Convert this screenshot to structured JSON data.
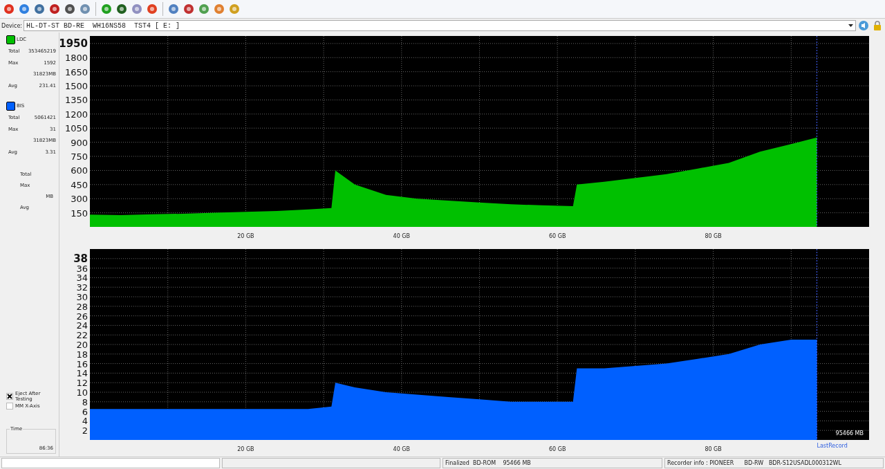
{
  "device": {
    "label": "Device:",
    "value": "HL-DT-ST BD-RE  WH16NS58  TST4 [ E: ]"
  },
  "stats": [
    {
      "rows": [
        {
          "label": "Total",
          "value": "353465219"
        },
        {
          "label": "Max",
          "value": "1592"
        },
        {
          "label": "",
          "value": "31823MB"
        },
        {
          "label": "Avg",
          "value": "231.41"
        }
      ]
    },
    {
      "rows": [
        {
          "label": "Total",
          "value": "5061421"
        },
        {
          "label": "Max",
          "value": "31"
        },
        {
          "label": "",
          "value": "31823MB"
        },
        {
          "label": "Avg",
          "value": "3.31"
        }
      ]
    }
  ],
  "extra_stats": [
    "Total",
    "Max",
    "MB",
    "Avg"
  ],
  "options": [
    {
      "label": "Eject After Testing",
      "checked": true
    },
    {
      "label": "MM X-Axis",
      "checked": false
    }
  ],
  "time": {
    "label": "Time",
    "value": "86:36"
  },
  "charts": [
    {
      "chart_data": {
        "type": "area",
        "grid": true,
        "ref_lines": [
          {
            "axis": "x",
            "value": 93.3
          }
        ],
        "xlim": [
          0,
          100
        ],
        "ylim": [
          0,
          2030
        ],
        "xticks": [
          {
            "value": 20,
            "label": "20 GB"
          },
          {
            "value": 40,
            "label": "40 GB"
          },
          {
            "value": 60,
            "label": "60 GB"
          },
          {
            "value": 80,
            "label": "80 GB"
          }
        ],
        "yticks": [
          150,
          300,
          450,
          600,
          750,
          900,
          1050,
          1200,
          1350,
          1500,
          1650,
          1800,
          1950
        ],
        "x": [
          0,
          4,
          8,
          12,
          16,
          20,
          24,
          28,
          31,
          31.5,
          34,
          38,
          42,
          46,
          50,
          54,
          58,
          62,
          62.5,
          66,
          70,
          74,
          78,
          82,
          86,
          90,
          93.3
        ],
        "series": [
          {
            "name": "LDC",
            "color": "#00c000",
            "values": [
              130,
              125,
              135,
              140,
              150,
              160,
              170,
              185,
              200,
              600,
              450,
              340,
              300,
              280,
              260,
              240,
              230,
              220,
              450,
              480,
              520,
              560,
              620,
              680,
              800,
              880,
              950
            ]
          }
        ]
      }
    },
    {
      "chart_data": {
        "type": "area",
        "grid": true,
        "ref_lines": [
          {
            "axis": "x",
            "value": 93.3
          }
        ],
        "xlim": [
          0,
          100
        ],
        "ylim": [
          0,
          40
        ],
        "xticks": [
          {
            "value": 20,
            "label": "20 GB"
          },
          {
            "value": 40,
            "label": "40 GB"
          },
          {
            "value": 60,
            "label": "60 GB"
          },
          {
            "value": 80,
            "label": "80 GB"
          }
        ],
        "yticks": [
          2,
          4,
          6,
          8,
          10,
          12,
          14,
          16,
          18,
          20,
          22,
          24,
          26,
          28,
          30,
          32,
          34,
          36,
          38
        ],
        "x": [
          0,
          4,
          8,
          12,
          16,
          20,
          24,
          28,
          31,
          31.5,
          34,
          38,
          42,
          46,
          50,
          54,
          58,
          62,
          62.5,
          66,
          70,
          74,
          78,
          82,
          86,
          90,
          93.3
        ],
        "series": [
          {
            "name": "BIS",
            "color": "#0060ff",
            "values": [
              6.5,
              6.5,
              6.5,
              6.5,
              6.5,
              6.5,
              6.5,
              6.5,
              7,
              12,
              11,
              10,
              9.5,
              9,
              8.5,
              8,
              8,
              8,
              15,
              15,
              15.5,
              16,
              17,
              18,
              20,
              21,
              21
            ]
          }
        ]
      },
      "end_label": "95466 MB",
      "end_link": "LastRecord"
    }
  ],
  "status_bar": {
    "disc": "Finalized  BD-ROM    95466 MB",
    "recorder": "Recorder info : PIONEER      BD-RW   BDR-S12USADL000312WL"
  }
}
